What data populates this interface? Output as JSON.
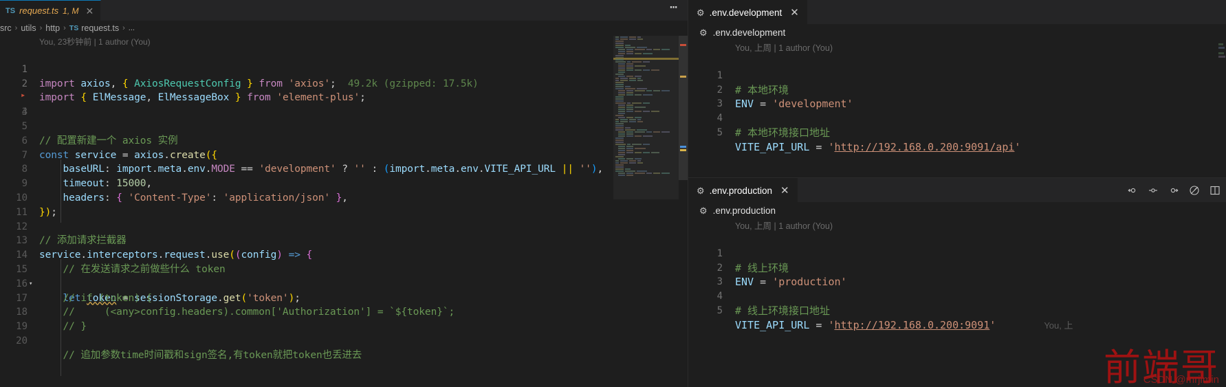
{
  "left_group": {
    "tab": {
      "icon": "typescript-file-icon",
      "icon_text": "TS",
      "label": "request.ts",
      "badge": "1, M",
      "close": "✕"
    },
    "tabbar_more": "⋯",
    "breadcrumb": {
      "items": [
        "src",
        "utils",
        "http",
        "request.ts",
        "..."
      ],
      "ts_icon_text": "TS",
      "separator": "›"
    },
    "blame": "You, 23秒钟前 | 1 author (You)",
    "bundle_info": "49.2k (gzipped: 17.5k)",
    "lines": [
      {
        "n": "1",
        "code": "import axios, { AxiosRequestConfig } from 'axios';"
      },
      {
        "n": "2",
        "code": "import { ElMessage, ElMessageBox } from 'element-plus';"
      },
      {
        "n": "3",
        "code": ""
      },
      {
        "n": "4",
        "code": ""
      },
      {
        "n": "5",
        "code": "// 配置新建一个 axios 实例"
      },
      {
        "n": "6",
        "code": "const service = axios.create({"
      },
      {
        "n": "7",
        "code": "    baseURL: import.meta.env.MODE == 'development' ? '' : (import.meta.env.VITE_API_URL || ''),"
      },
      {
        "n": "8",
        "code": "    timeout: 15000,"
      },
      {
        "n": "9",
        "code": "    headers: { 'Content-Type': 'application/json' },"
      },
      {
        "n": "10",
        "code": "});"
      },
      {
        "n": "11",
        "code": ""
      },
      {
        "n": "12",
        "code": "// 添加请求拦截器"
      },
      {
        "n": "13",
        "code": "service.interceptors.request.use((config) => {"
      },
      {
        "n": "14",
        "code": "    // 在发送请求之前做些什么 token"
      },
      {
        "n": "15",
        "code": "    let token = sessionStorage.get('token');"
      },
      {
        "n": "16",
        "code": "    // if (token) {"
      },
      {
        "n": "17",
        "code": "    //     (<any>config.headers).common['Authorization'] = `${token}`;"
      },
      {
        "n": "18",
        "code": "    // }"
      },
      {
        "n": "19",
        "code": ""
      },
      {
        "n": "20",
        "code": "    // 追加参数time时间戳和sign签名,有token就把token也丢进去"
      }
    ]
  },
  "right_group": {
    "dev": {
      "tab_label": ".env.development",
      "tab_icon": "gear-icon",
      "tab_close": "✕",
      "path_label": ".env.development",
      "blame": "You, 上周 | 1 author (You)",
      "lines": [
        {
          "n": "1",
          "kind": "comment",
          "text": "# 本地环境"
        },
        {
          "n": "2",
          "kind": "kv",
          "key": "ENV",
          "eq": " = ",
          "value": "'development'"
        },
        {
          "n": "3",
          "kind": "blank",
          "text": ""
        },
        {
          "n": "4",
          "kind": "comment",
          "text": "# 本地环境接口地址"
        },
        {
          "n": "5",
          "kind": "kv-link",
          "key": "VITE_API_URL",
          "eq": " = ",
          "quote_open": "'",
          "value": "http://192.168.0.200:9091/api",
          "quote_close": "'"
        }
      ]
    },
    "prod": {
      "tab_label": ".env.production",
      "tab_icon": "gear-icon",
      "tab_close": "✕",
      "path_label": ".env.production",
      "blame": "You, 上周 | 1 author (You)",
      "toolbar_icons": [
        "previous-change-icon",
        "open-change-icon",
        "next-change-icon",
        "toggle-inline-view-icon",
        "split-editor-icon"
      ],
      "lines": [
        {
          "n": "1",
          "kind": "comment",
          "text": "# 线上环境"
        },
        {
          "n": "2",
          "kind": "kv",
          "key": "ENV",
          "eq": " = ",
          "value": "'production'"
        },
        {
          "n": "3",
          "kind": "blank",
          "text": ""
        },
        {
          "n": "4",
          "kind": "comment",
          "text": "# 线上环境接口地址"
        },
        {
          "n": "5",
          "kind": "kv-link",
          "key": "VITE_API_URL",
          "eq": " = ",
          "quote_open": "'",
          "value": "http://192.168.0.200:9091",
          "quote_close": "'"
        }
      ],
      "trailing_blame": "You, 上"
    }
  },
  "watermark": {
    "chinese": "前端哥",
    "credit": "CSDN @mrjimin"
  },
  "colors": {
    "editor_bg": "#1e1e1e",
    "tabbar_bg": "#252526",
    "active_tab_border": "#0d7ab7",
    "modified_tab_text": "#e8ab53",
    "comment": "#6a9955",
    "string": "#ce9178",
    "keyword": "#569cd6",
    "control_keyword": "#c586c0",
    "type": "#4ec9b0",
    "number": "#b5cea8",
    "variable": "#9cdcfe",
    "watermark_red": "#a51212"
  }
}
